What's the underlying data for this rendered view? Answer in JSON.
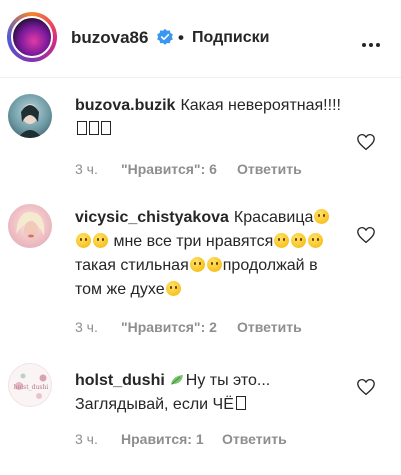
{
  "header": {
    "username": "buzova86",
    "separator": "•",
    "follow_label": "Подписки"
  },
  "comments": [
    {
      "username": "buzova.buzik",
      "text": "Какая невероятная!!!!",
      "time": "3 ч.",
      "likes": "\"Нравится\": 6",
      "reply": "Ответить"
    },
    {
      "username": "vicysic_chistyakova",
      "text_parts": [
        "Красавица",
        "мне все три нравятся",
        "такая стильная",
        "продолжай в том же духе"
      ],
      "time": "3 ч.",
      "likes": "\"Нравится\": 2",
      "reply": "Ответить"
    },
    {
      "username": "holst_dushi",
      "text_a": "Ну ты это...",
      "text_b": "Заглядывай, если ЧЁ",
      "avatar_caption": "holst_dushi",
      "time": "3 ч.",
      "likes": "Нравится: 1",
      "reply": "Ответить"
    }
  ],
  "icons": {
    "verified": "verified-badge-icon",
    "more": "more-options-icon",
    "heart": "heart-outline-icon",
    "leaf": "leaf-emoji-icon"
  },
  "colors": {
    "text": "#262626",
    "meta": "#8e8e8e",
    "verified": "#3897f0",
    "divider": "#efefef"
  }
}
